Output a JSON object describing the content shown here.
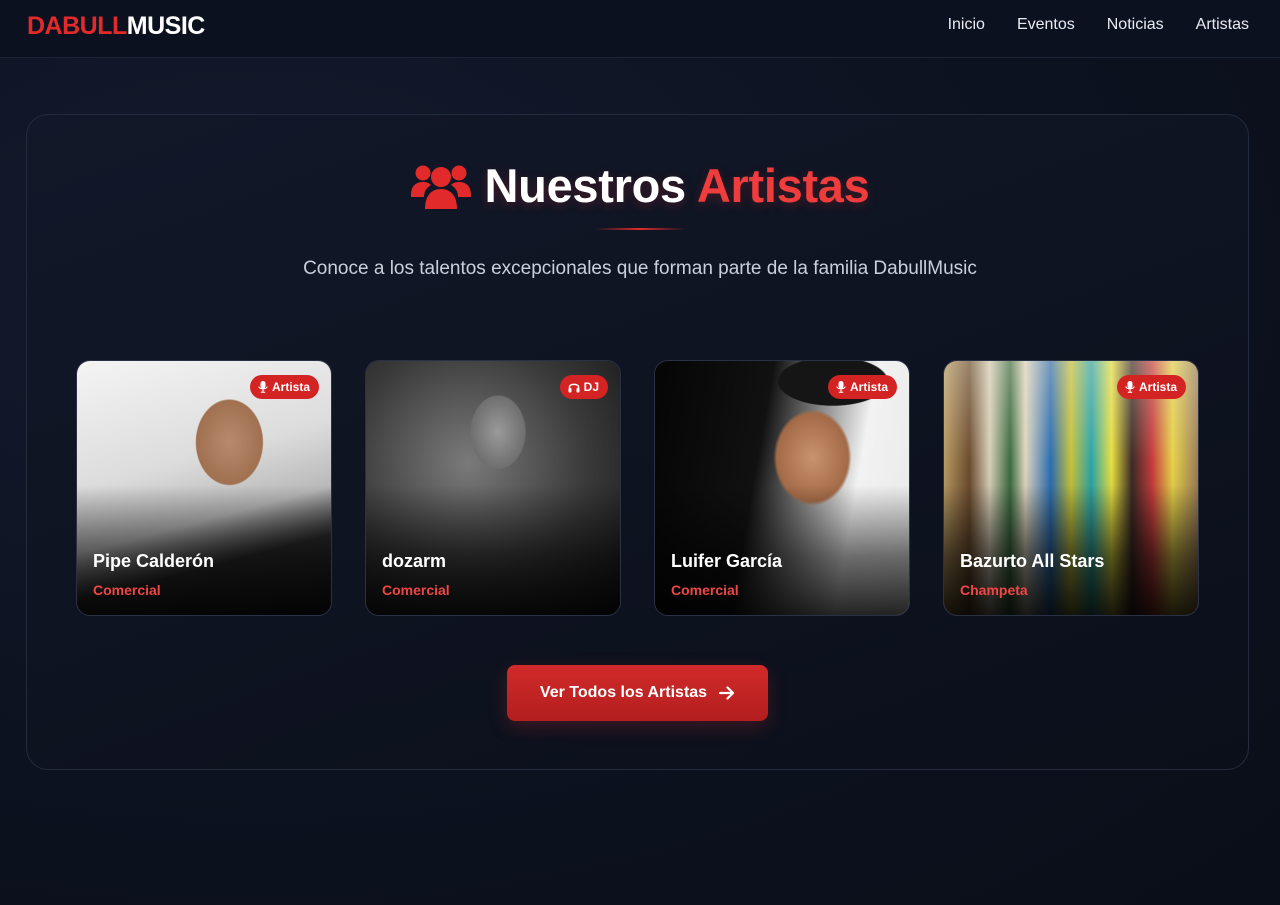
{
  "brand": {
    "part1": "DABULL",
    "part2": "MUSIC",
    "accent_color": "#e22a2a"
  },
  "nav": {
    "items": [
      {
        "label": "Inicio"
      },
      {
        "label": "Eventos"
      },
      {
        "label": "Noticias"
      },
      {
        "label": "Artistas"
      }
    ]
  },
  "section": {
    "icon": "users-icon",
    "title_main": "Nuestros",
    "title_accent": "Artistas",
    "subtitle": "Conoce a los talentos excepcionales que forman parte de la familia DabullMusic"
  },
  "artists": [
    {
      "name": "Pipe Calderón",
      "genre": "Comercial",
      "badge": "Artista",
      "badge_icon": "microphone-icon"
    },
    {
      "name": "dozarm",
      "genre": "Comercial",
      "badge": "DJ",
      "badge_icon": "headphones-icon"
    },
    {
      "name": "Luifer García",
      "genre": "Comercial",
      "badge": "Artista",
      "badge_icon": "microphone-icon"
    },
    {
      "name": "Bazurto All Stars",
      "genre": "Champeta",
      "badge": "Artista",
      "badge_icon": "microphone-icon"
    }
  ],
  "cta": {
    "label": "Ver Todos los Artistas",
    "icon": "arrow-right-icon"
  },
  "colors": {
    "background": "#0d1220",
    "accent": "#e22a2a",
    "badge": "#d42323",
    "genre_text": "#ef4646"
  }
}
